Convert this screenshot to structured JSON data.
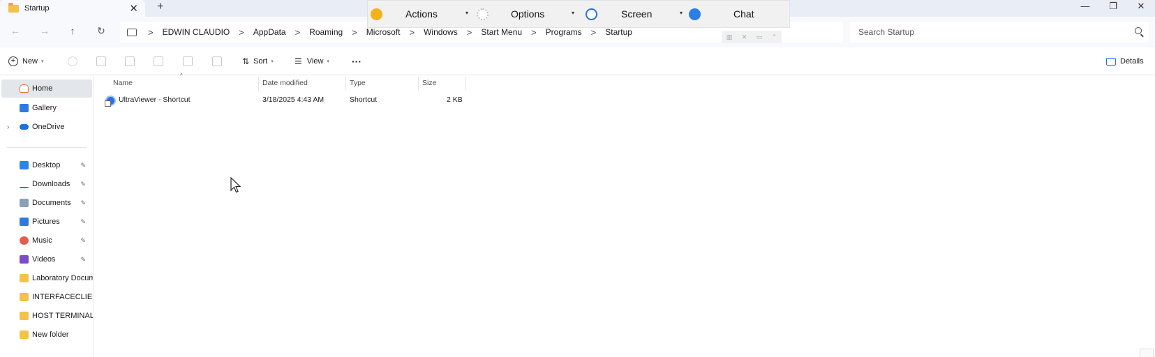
{
  "window": {
    "tab_title": "Startup",
    "tab_close": "✕",
    "new_tab": "+",
    "minimize": "—",
    "restore": "❐",
    "close": "✕"
  },
  "remote_toolbar": {
    "actions_label": "Actions",
    "options_label": "Options",
    "screen_label": "Screen",
    "chat_label": "Chat",
    "caret": "▾",
    "accent_colors": {
      "actions": "#f2b21b",
      "screen": "#2d6fd8",
      "chat": "#2a7ee6"
    }
  },
  "nav": {
    "back": "←",
    "forward": "→",
    "up": "↑",
    "refresh": "↻",
    "breadcrumb": [
      "EDWIN CLAUDIO",
      "AppData",
      "Roaming",
      "Microsoft",
      "Windows",
      "Start Menu",
      "Programs",
      "Startup"
    ],
    "separator": ">",
    "search_placeholder": "Search Startup"
  },
  "toolbar": {
    "new_label": "New",
    "sort_label": "Sort",
    "view_label": "View",
    "more_label": "···",
    "details_label": "Details",
    "caret": "▾"
  },
  "sidebar": {
    "top_items": [
      {
        "label": "Home",
        "icon": "home-icon",
        "selected": true
      },
      {
        "label": "Gallery",
        "icon": "gallery-icon"
      },
      {
        "label": "OneDrive",
        "icon": "cloud-icon",
        "expandable": true
      }
    ],
    "quick_access": [
      {
        "label": "Desktop",
        "icon": "desktop-icon",
        "pinned": true
      },
      {
        "label": "Downloads",
        "icon": "download-icon",
        "pinned": true
      },
      {
        "label": "Documents",
        "icon": "document-icon",
        "pinned": true
      },
      {
        "label": "Pictures",
        "icon": "pictures-icon",
        "pinned": true
      },
      {
        "label": "Music",
        "icon": "music-icon",
        "pinned": true
      },
      {
        "label": "Videos",
        "icon": "videos-icon",
        "pinned": true
      },
      {
        "label": "Laboratory Docume",
        "icon": "folder-icon"
      },
      {
        "label": "INTERFACECLIENT_",
        "icon": "folder-icon"
      },
      {
        "label": "HOST TERMINAL T(",
        "icon": "folder-icon"
      },
      {
        "label": "New folder",
        "icon": "folder-icon"
      }
    ],
    "expand_glyph": "›",
    "pin_glyph": "📌"
  },
  "files": {
    "columns": [
      "Name",
      "Date modified",
      "Type",
      "Size"
    ],
    "sort_glyph": "^",
    "rows": [
      {
        "name": "UltraViewer - Shortcut",
        "date": "3/18/2025 4:43 AM",
        "type": "Shortcut",
        "size": "2 KB"
      }
    ]
  }
}
